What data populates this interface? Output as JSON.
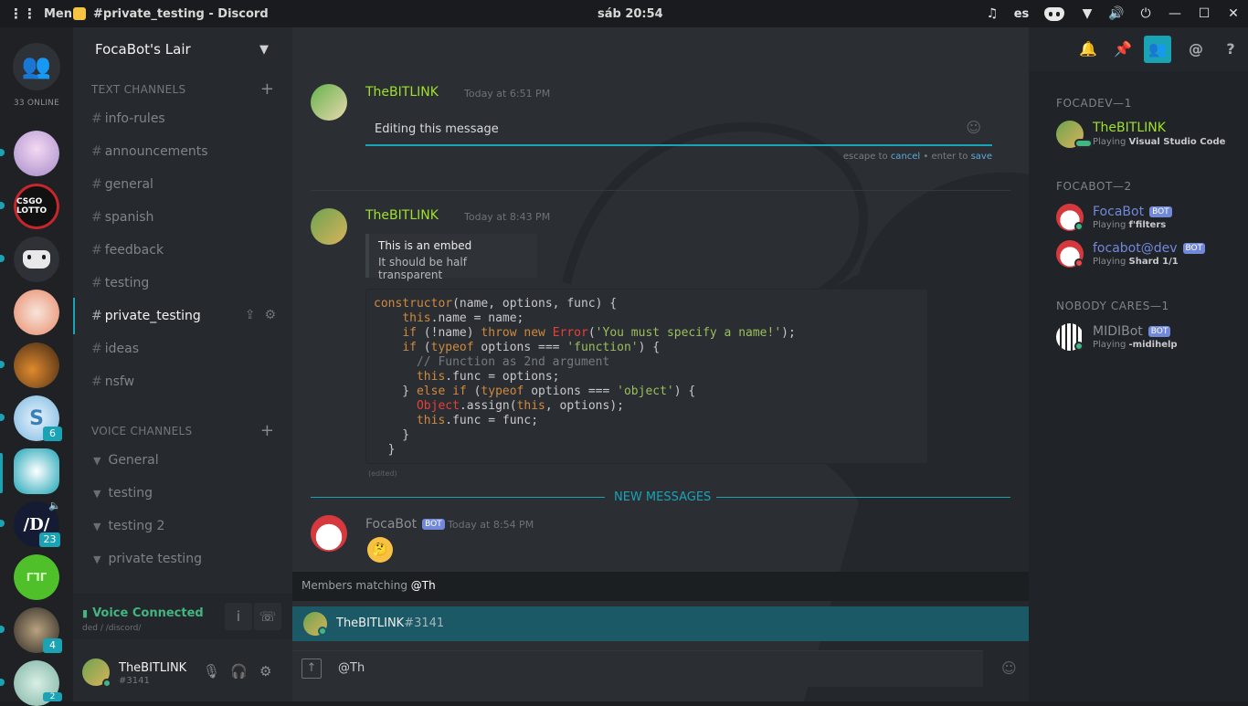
{
  "topbar": {
    "menu_label": "Menu",
    "app_title": "#private_testing - Discord",
    "clock": "sáb 20:54",
    "language": "es"
  },
  "guilds": {
    "online_count": "33 ONLINE",
    "badges": [
      "6",
      "23",
      "4",
      "2"
    ],
    "csgo_label": "CSGO LOTTO"
  },
  "server": {
    "name": "FocaBot's Lair"
  },
  "text_channels": {
    "header": "TEXT CHANNELS",
    "items": [
      "info-rules",
      "announcements",
      "general",
      "spanish",
      "feedback",
      "testing",
      "private_testing",
      "ideas",
      "nsfw"
    ],
    "selected": "private_testing"
  },
  "voice_channels": {
    "header": "VOICE CHANNELS",
    "items": [
      "General",
      "testing",
      "testing 2",
      "private testing"
    ]
  },
  "voice_connection": {
    "status": "Voice Connected",
    "sub": "ded / /discord/"
  },
  "user": {
    "name": "TheBITLINK",
    "tag": "#3141"
  },
  "channel_header": {
    "name": "private_testing"
  },
  "messages": [
    {
      "author": "TheBITLINK",
      "time": "Today at 6:51 PM",
      "editing_text": "Editing this message",
      "hint_prefix": "escape to",
      "hint_cancel": "cancel",
      "hint_mid": "• enter to",
      "hint_save": "save"
    },
    {
      "author": "TheBITLINK",
      "time": "Today at 8:43 PM",
      "embed_title": "This is an embed",
      "embed_desc": "It should be half transparent",
      "edited": "(edited)"
    },
    {
      "author": "FocaBot",
      "bot_tag": "BOT",
      "time": "Today at 8:54 PM"
    }
  ],
  "new_messages_label": "NEW MESSAGES",
  "autocomplete": {
    "header_prefix": "Members matching",
    "query": "@Th",
    "result_name": "TheBITLINK",
    "result_tag": "#3141"
  },
  "input": {
    "value": "@Th"
  },
  "members": {
    "groups": [
      {
        "title": "FOCADEV—1",
        "members": [
          {
            "name": "TheBITLINK",
            "playing_prefix": "Playing",
            "game": "Visual Studio Code",
            "color": "#9ee02c"
          }
        ]
      },
      {
        "title": "FOCABOT—2",
        "members": [
          {
            "name": "FocaBot",
            "bot": "BOT",
            "playing_prefix": "Playing",
            "game": "f'filters",
            "color": "#7289da"
          },
          {
            "name": "focabot@dev",
            "bot": "BOT",
            "playing_prefix": "Playing",
            "game": "Shard 1/1",
            "color": "#7289da"
          }
        ]
      },
      {
        "title": "NOBODY CARES—1",
        "members": [
          {
            "name": "MIDIBot",
            "bot": "BOT",
            "playing_prefix": "Playing",
            "game": "-midihelp",
            "color": "#8b8f94"
          }
        ]
      }
    ]
  },
  "colors": {
    "accent": "#1aa3b5",
    "online": "#43b581",
    "dev_name": "#9ee02c",
    "bot_name": "#7289da"
  }
}
